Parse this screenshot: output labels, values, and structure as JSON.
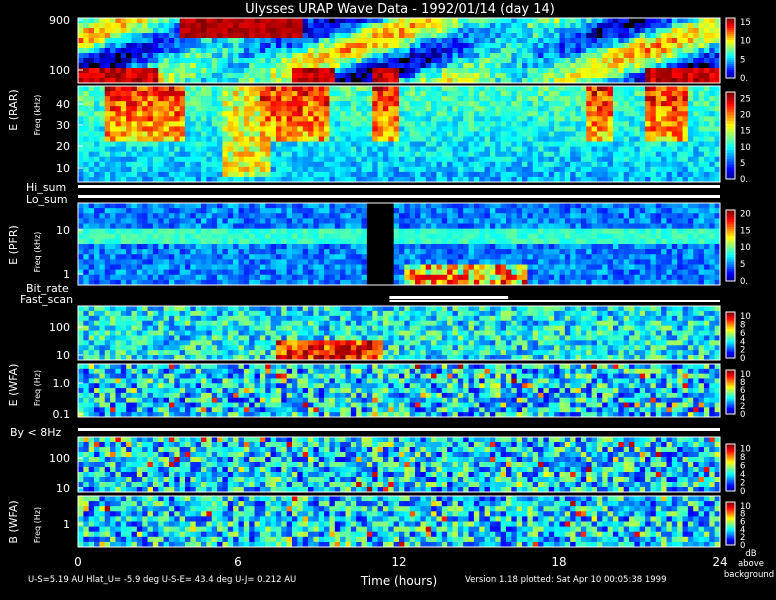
{
  "title": "Ulysses URAP Wave Data - 1992/01/14  (day 14)",
  "footer": {
    "info": "U-S=5.19 AU   Hlat_U= -5.9 deg   U-S-E= 43.4 deg   U-J= 0.212 AU",
    "version": "Version 1.18 plotted: Sat Apr 10 00:05:38 1999",
    "units": [
      "dB",
      "above",
      "background"
    ]
  },
  "x_axis": {
    "label": "Time (hours)",
    "ticks": [
      "0",
      "6",
      "12",
      "18",
      "24"
    ],
    "range": [
      0,
      24
    ]
  },
  "strip_labels": [
    "Hi_sum",
    "Lo_sum",
    "Bit_rate",
    "Fast_scan",
    "By < 8Hz"
  ],
  "colors": {
    "background": "#000000",
    "text": "#ffffff"
  },
  "chart_data": {
    "type": "heatmap",
    "panels": [
      {
        "instrument": "E (RAR)",
        "freq_label": "Freq (kHz)",
        "scale": "log",
        "y_ticks": [
          "900",
          "100"
        ],
        "colorbar_ticks": [
          "15",
          "10",
          "5",
          "0."
        ],
        "colorbar_range": [
          0,
          16
        ]
      },
      {
        "instrument": "E (RAR)",
        "freq_label": "Freq (kHz)",
        "scale": "log",
        "y_ticks": [
          "40",
          "30",
          "20",
          "10"
        ],
        "colorbar_ticks": [
          "25",
          "20",
          "15",
          "10",
          "5",
          "0."
        ],
        "colorbar_range": [
          0,
          27
        ]
      },
      {
        "instrument": "E (PFR)",
        "freq_label": "Freq (kHz)",
        "scale": "log",
        "y_ticks": [
          "10",
          "1"
        ],
        "colorbar_ticks": [
          "20",
          "15",
          "10",
          "5",
          "0."
        ],
        "colorbar_range": [
          0,
          21
        ]
      },
      {
        "instrument": "E (WFA)",
        "freq_label": "Freq (Hz)",
        "scale": "log",
        "y_ticks": [
          "100",
          "10"
        ],
        "colorbar_ticks": [
          "10",
          "8",
          "6",
          "4",
          "2",
          "0"
        ],
        "colorbar_range": [
          0,
          11
        ]
      },
      {
        "instrument": "E (WFA)",
        "freq_label": "Freq (Hz)",
        "scale": "log",
        "y_ticks": [
          "1.0",
          "0.1"
        ],
        "colorbar_ticks": [
          "10",
          "8",
          "6",
          "4",
          "2",
          "0"
        ],
        "colorbar_range": [
          0,
          11
        ]
      },
      {
        "instrument": "B (WFA)",
        "freq_label": "Freq (Hz)",
        "scale": "log",
        "y_ticks": [
          "100",
          "10"
        ],
        "colorbar_ticks": [
          "10",
          "8",
          "6",
          "4",
          "2",
          "0"
        ],
        "colorbar_range": [
          0,
          11
        ]
      },
      {
        "instrument": "B (WFA)",
        "freq_label": "Freq (Hz)",
        "scale": "log",
        "y_ticks": [
          "1"
        ],
        "colorbar_ticks": [
          "10",
          "8",
          "6",
          "4",
          "2",
          "0"
        ],
        "colorbar_range": [
          0,
          11
        ]
      }
    ]
  }
}
